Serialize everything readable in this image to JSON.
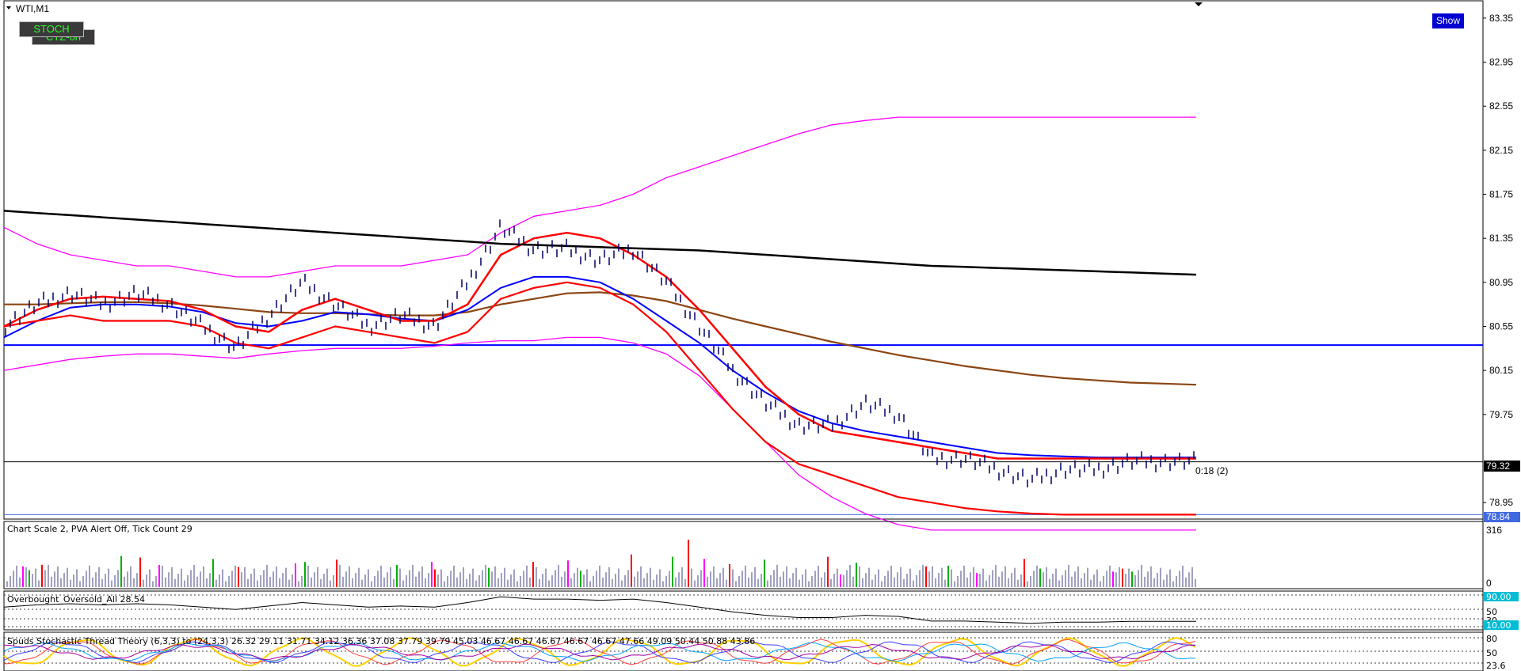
{
  "header": {
    "symbol_label": "WTI,M1",
    "stoch_button": "STOCH",
    "ctz_button": "CTZ-on",
    "show_button": "Show"
  },
  "colors": {
    "sma_red": "#ff0000",
    "sma_blue": "#0000ff",
    "sma_brown": "#8b4513",
    "sma_teal": "#2e8b57",
    "envelope": "#ff00ff",
    "band": "#404040",
    "trendline": "#000000",
    "hline": "#0000ff",
    "vol_up": "#00b000",
    "vol_down": "#ff0000",
    "vol_climax": "#ff00ff",
    "vol_normal": "#a0a0c0",
    "stoch_yellow": "#ffd000"
  },
  "chart_data": [
    {
      "type": "line",
      "panel": "price",
      "ylim": [
        78.8,
        83.5
      ],
      "yticks": [
        83.35,
        82.95,
        82.55,
        82.15,
        81.75,
        81.35,
        80.95,
        80.55,
        80.15,
        79.75,
        78.95
      ],
      "price_tags": {
        "current": "79.32",
        "hline_low": "78.84"
      },
      "timer_label": "0:18 (2)",
      "price_series": {
        "x": [
          0,
          40,
          80,
          120,
          160,
          200,
          240,
          280,
          320,
          360,
          400,
          440,
          480,
          520,
          560,
          580,
          600,
          620,
          640,
          660,
          680,
          700,
          720,
          740,
          760,
          780,
          800,
          820,
          840,
          860,
          880,
          900,
          920,
          940,
          960,
          980,
          1000
        ],
        "y": [
          80.55,
          80.75,
          80.85,
          80.75,
          80.85,
          80.75,
          80.55,
          80.35,
          80.65,
          80.95,
          80.75,
          80.55,
          80.65,
          80.55,
          80.95,
          81.45,
          81.25,
          81.25,
          81.15,
          81.25,
          80.95,
          80.55,
          80.15,
          79.85,
          79.65,
          79.65,
          79.85,
          79.75,
          79.35,
          79.35,
          79.25,
          79.15,
          79.25,
          79.25,
          79.32,
          79.32,
          79.32
        ]
      },
      "fast_ma_red": [
        80.55,
        80.7,
        80.8,
        80.82,
        80.8,
        80.78,
        80.7,
        80.55,
        80.5,
        80.7,
        80.8,
        80.7,
        80.6,
        80.6,
        80.75,
        81.2,
        81.35,
        81.4,
        81.35,
        81.2,
        81.0,
        80.7,
        80.35,
        80.0,
        79.75,
        79.6,
        79.55,
        79.5,
        79.45,
        79.4,
        79.35,
        79.35,
        79.35,
        79.35,
        79.35,
        79.35,
        79.35
      ],
      "mid_ma_blue": [
        80.45,
        80.6,
        80.72,
        80.75,
        80.75,
        80.73,
        80.68,
        80.58,
        80.55,
        80.6,
        80.68,
        80.66,
        80.62,
        80.6,
        80.7,
        80.9,
        81.0,
        81.0,
        80.95,
        80.8,
        80.6,
        80.4,
        80.15,
        79.95,
        79.78,
        79.67,
        79.6,
        79.55,
        79.5,
        79.45,
        79.4,
        79.38,
        79.37,
        79.36,
        79.36,
        79.36,
        79.36
      ],
      "slow_ma_brown": [
        80.75,
        80.75,
        80.76,
        80.77,
        80.77,
        80.76,
        80.74,
        80.71,
        80.68,
        80.67,
        80.67,
        80.66,
        80.65,
        80.65,
        80.68,
        80.75,
        80.8,
        80.85,
        80.86,
        80.83,
        80.78,
        80.7,
        80.62,
        80.55,
        80.48,
        80.41,
        80.35,
        80.29,
        80.24,
        80.19,
        80.15,
        80.11,
        80.08,
        80.06,
        80.04,
        80.03,
        80.02
      ],
      "lower_red_band": [
        80.55,
        80.6,
        80.65,
        80.6,
        80.6,
        80.6,
        80.55,
        80.4,
        80.35,
        80.45,
        80.55,
        80.5,
        80.45,
        80.4,
        80.5,
        80.8,
        80.9,
        80.95,
        80.9,
        80.75,
        80.5,
        80.15,
        79.8,
        79.5,
        79.3,
        79.2,
        79.1,
        79.0,
        78.95,
        78.9,
        78.87,
        78.85,
        78.84,
        78.84,
        78.84,
        78.84,
        78.84
      ],
      "upper_envelope": [
        81.45,
        81.3,
        81.2,
        81.15,
        81.1,
        81.1,
        81.05,
        81.0,
        81.0,
        81.05,
        81.1,
        81.1,
        81.1,
        81.15,
        81.2,
        81.4,
        81.55,
        81.6,
        81.65,
        81.75,
        81.9,
        82.0,
        82.1,
        82.2,
        82.3,
        82.38,
        82.42,
        82.45,
        82.45,
        82.45,
        82.45,
        82.45,
        82.45,
        82.45,
        82.45,
        82.45,
        82.45
      ],
      "lower_envelope": [
        80.15,
        80.2,
        80.25,
        80.28,
        80.3,
        80.3,
        80.28,
        80.26,
        80.3,
        80.33,
        80.35,
        80.35,
        80.35,
        80.37,
        80.4,
        80.42,
        80.42,
        80.45,
        80.45,
        80.4,
        80.3,
        80.1,
        79.8,
        79.5,
        79.2,
        79.0,
        78.85,
        78.75,
        78.7,
        78.7,
        78.7,
        78.7,
        78.7,
        78.7,
        78.7,
        78.7,
        78.7
      ],
      "resistance_line": [
        81.6,
        81.58,
        81.56,
        81.54,
        81.52,
        81.5,
        81.48,
        81.46,
        81.44,
        81.42,
        81.4,
        81.38,
        81.36,
        81.34,
        81.32,
        81.3,
        81.29,
        81.28,
        81.27,
        81.26,
        81.25,
        81.24,
        81.22,
        81.2,
        81.18,
        81.16,
        81.14,
        81.12,
        81.1,
        81.09,
        81.08,
        81.07,
        81.06,
        81.05,
        81.04,
        81.03,
        81.02
      ],
      "horizontal_line": 80.38
    },
    {
      "type": "bar",
      "panel": "volume",
      "label": "Chart Scale  2,   PVA Alert Off,   Tick Count  29",
      "ylim": [
        0,
        316
      ],
      "yticks": [
        316,
        0
      ]
    },
    {
      "type": "line",
      "panel": "oscillator",
      "label": "Overbought_Oversold_All 28.54",
      "levels": [
        "90.00",
        "50",
        "30",
        "10.00"
      ]
    },
    {
      "type": "line",
      "panel": "stochastic",
      "label": "Spuds Stochastic Thread Theory (6,3,3) to (24,3,3) 26.32 29.11 31.71 34.12 36.36 37.08 37.79 39.79 45.03 46.67 46.67 46.67 46.67 46.67 47.66 49.09 50.44 50.88 43.86",
      "levels": [
        "80",
        "50",
        "23.6"
      ]
    }
  ]
}
